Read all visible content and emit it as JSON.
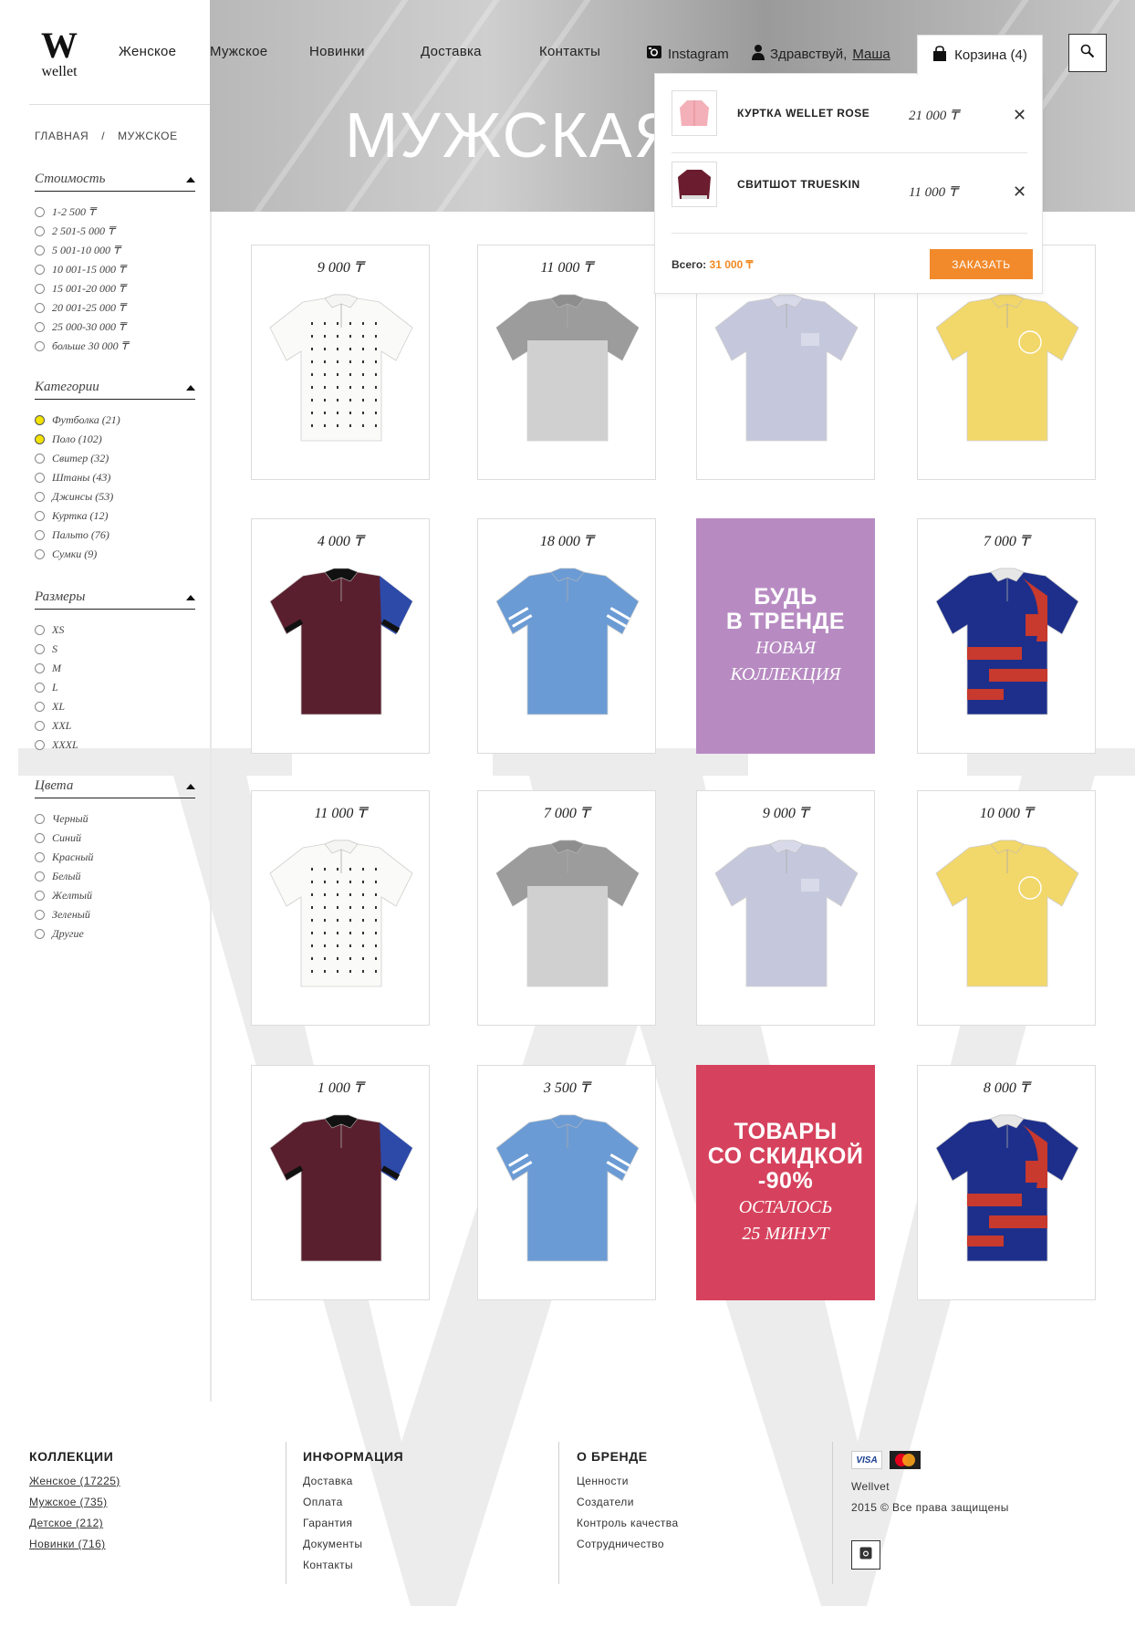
{
  "brand": {
    "mark": "W",
    "name": "wellet"
  },
  "nav": [
    {
      "label": "Женское"
    },
    {
      "label": "Мужское"
    },
    {
      "label": "Новинки"
    },
    {
      "label": "Доставка"
    },
    {
      "label": "Контакты"
    }
  ],
  "topbar": {
    "instagram_label": "Instagram",
    "greeting": "Здравствуй,",
    "user": "Маша",
    "cart_label": "Корзина (4)"
  },
  "hero": {
    "title": "МУЖСКАЯ"
  },
  "cart": {
    "items": [
      {
        "title": "КУРТКА WELLET ROSE",
        "price": "21 000 ₸"
      },
      {
        "title": "СВИТШОТ TRUESKIN",
        "price": "11 000 ₸"
      }
    ],
    "total_label": "Всего:",
    "total_value": "31 000 ₸",
    "order_label": "ЗАКАЗАТЬ",
    "remove_glyph": "✕"
  },
  "breadcrumbs": [
    "ГЛАВНАЯ",
    "/",
    "МУЖСКОЕ"
  ],
  "filters": {
    "price": {
      "title": "Стоимость",
      "options": [
        "1-2 500 ₸",
        "2 501-5 000 ₸",
        "5 001-10 000 ₸",
        "10 001-15 000 ₸",
        "15 001-20 000 ₸",
        "20 001-25 000 ₸",
        "25 000-30 000 ₸",
        "больше 30 000 ₸"
      ]
    },
    "categories": {
      "title": "Категории",
      "options": [
        "Футболка (21)",
        "Поло (102)",
        "Свитер (32)",
        "Штаны (43)",
        "Джинсы (53)",
        "Куртка (12)",
        "Пальто (76)",
        "Сумки (9)"
      ],
      "selected": [
        0,
        1
      ]
    },
    "sizes": {
      "title": "Размеры",
      "options": [
        "XS",
        "S",
        "M",
        "L",
        "XL",
        "XXL",
        "XXXL"
      ]
    },
    "colors": {
      "title": "Цвета",
      "options": [
        "Черный",
        "Синий",
        "Красный",
        "Белый",
        "Желтый",
        "Зеленый",
        "Другие"
      ]
    }
  },
  "products": [
    {
      "price": "9 000 ₸",
      "style": "white-dots"
    },
    {
      "price": "11 000 ₸",
      "style": "gray-block"
    },
    {
      "price": "",
      "style": "lavender"
    },
    {
      "price": "",
      "style": "yellow"
    },
    {
      "price": "4 000 ₸",
      "style": "maroon"
    },
    {
      "price": "18 000 ₸",
      "style": "blue-stripe"
    },
    {
      "promo": true,
      "color": "#b78bc2",
      "big": [
        "БУДЬ",
        "В ТРЕНДЕ"
      ],
      "small": [
        "НОВАЯ",
        "КОЛЛЕКЦИЯ"
      ]
    },
    {
      "price": "7 000 ₸",
      "style": "navy-red"
    },
    {
      "price": "11 000 ₸",
      "style": "white-dots"
    },
    {
      "price": "7 000 ₸",
      "style": "gray-block"
    },
    {
      "price": "9 000 ₸",
      "style": "lavender"
    },
    {
      "price": "10 000 ₸",
      "style": "yellow"
    },
    {
      "price": "1 000 ₸",
      "style": "maroon"
    },
    {
      "price": "3 500 ₸",
      "style": "blue-stripe"
    },
    {
      "promo": true,
      "color": "#d6425d",
      "big": [
        "ТОВАРЫ",
        "СО СКИДКОЙ",
        "-90%"
      ],
      "small": [
        "ОСТАЛОСЬ",
        "25 МИНУТ"
      ]
    },
    {
      "price": "8 000 ₸",
      "style": "navy-red"
    }
  ],
  "footer": {
    "collections": {
      "title": "КОЛЛЕКЦИИ",
      "links": [
        "Женское (17225)",
        "Мужское (735)",
        "Детское (212)",
        "Новинки (716)"
      ]
    },
    "info": {
      "title": "ИНФОРМАЦИЯ",
      "links": [
        "Доставка",
        "Оплата",
        "Гарантия",
        "Документы",
        "Контакты"
      ]
    },
    "brand": {
      "title": "О БРЕНДЕ",
      "links": [
        "Ценности",
        "Создатели",
        "Контроль качества",
        "Сотрудничество"
      ]
    },
    "company": {
      "visa": "VISA",
      "name": "Wellvet",
      "copyright": "2015 © Все права защищены"
    }
  },
  "colors": {
    "accent_orange": "#f28a2c",
    "promo_purple": "#b78bc2",
    "promo_red": "#d6425d",
    "radio_selected": "#f2e300"
  }
}
